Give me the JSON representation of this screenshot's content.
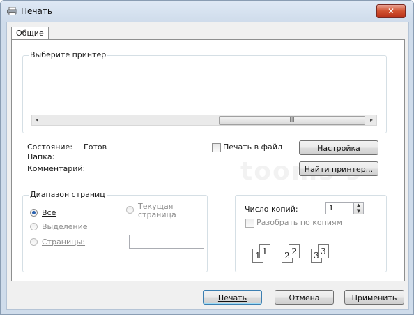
{
  "window": {
    "title": "Печать",
    "close_label": "✕"
  },
  "tabs": [
    {
      "label": "Общие"
    }
  ],
  "printer_group": {
    "legend": "Выберите принтер",
    "scroll_thumb_label": "III",
    "status_label": "Состояние:",
    "status_value": "Готов",
    "folder_label": "Папка:",
    "comment_label": "Комментарий:",
    "print_to_file_label": "Печать в файл",
    "settings_button": "Настройка",
    "find_printer_button": "Найти принтер..."
  },
  "range_group": {
    "legend": "Диапазон страниц",
    "all_label": "Все",
    "current_page_line1": "Текущая",
    "current_page_line2": "страница",
    "selection_label": "Выделение",
    "pages_label": "Страницы:",
    "pages_value": ""
  },
  "copies_group": {
    "copies_label": "Число копий:",
    "copies_value": "1",
    "collate_label": "Разобрать по копиям",
    "collate_pages": [
      "1",
      "1",
      "2",
      "2",
      "3",
      "3"
    ]
  },
  "footer": {
    "print_button": "Печать",
    "cancel_button": "Отмена",
    "apply_button": "Применить"
  },
  "watermark_text": "tooms 9"
}
